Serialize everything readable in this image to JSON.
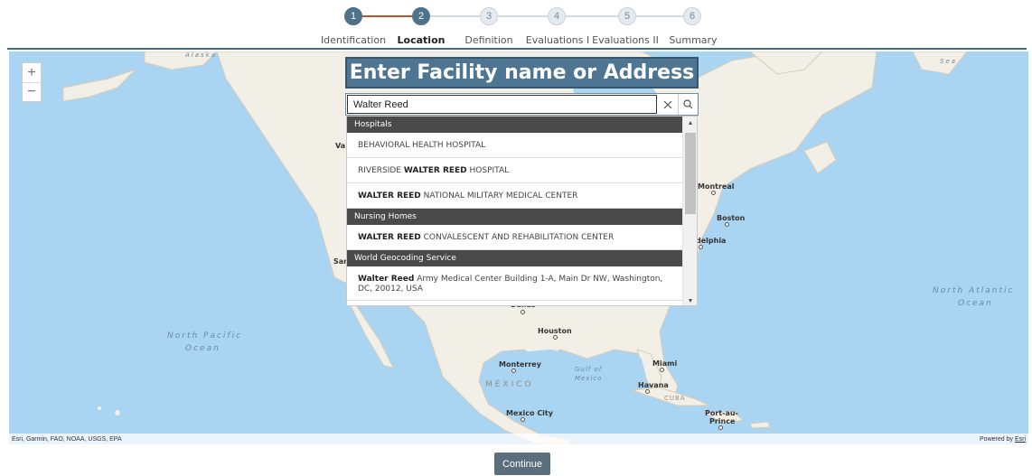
{
  "stepper": {
    "current_step": 2,
    "steps": [
      {
        "number": "1",
        "label": "Identification"
      },
      {
        "number": "2",
        "label": "Location"
      },
      {
        "number": "3",
        "label": "Definition"
      },
      {
        "number": "4",
        "label": "Evaluations I"
      },
      {
        "number": "5",
        "label": "Evaluations II"
      },
      {
        "number": "6",
        "label": "Summary"
      }
    ]
  },
  "search": {
    "title": "Enter Facility name or Address",
    "value": "Walter Reed",
    "clear_icon": "close-icon",
    "submit_icon": "search-icon"
  },
  "suggestions": {
    "hospitals_header": "Hospitals",
    "hospital_1": "BEHAVIORAL HEALTH HOSPITAL",
    "hospital_2_pre": "RIVERSIDE ",
    "hospital_2_match": "WALTER REED",
    "hospital_2_post": " HOSPITAL",
    "hospital_3_match": "WALTER REED",
    "hospital_3_post": " NATIONAL MILITARY MEDICAL CENTER",
    "nursing_header": "Nursing Homes",
    "nursing_1_match": "WALTER REED",
    "nursing_1_post": " CONVALESCENT AND REHABILITATION CENTER",
    "geocode_header": "World Geocoding Service",
    "geocode_1_match": "Walter Reed",
    "geocode_1_post": " Army Medical Center Building 1-A, Main Dr NW, Washington, DC, 20012, USA"
  },
  "map": {
    "zoom_in": "+",
    "zoom_out": "−",
    "labels": {
      "north_pacific": "North Pacific",
      "ocean_1": "Ocean",
      "north_atlantic": "North Atlantic",
      "ocean_2": "Ocean",
      "montreal": "Montreal",
      "boston": "Boston",
      "philadelphia": "delphia",
      "houston": "Houston",
      "dallas": "Dallas",
      "monterrey": "Monterrey",
      "mexico_country": "MÉXICO",
      "gulf": "Gulf of",
      "gulf_2": "Mexico",
      "miami": "Miami",
      "havana": "Havana",
      "cuba": "CUBA",
      "mexico_city": "Mexico City",
      "port_au_prince_1": "Port-au-",
      "port_au_prince_2": "Prince",
      "vancouver_partial": "Va",
      "san_partial": "San",
      "alaska_partial": "Alaska",
      "sea_partial": "Sea"
    },
    "attribution": "Esri, Garmin, FAO, NOAA, USGS, EPA",
    "powered_by": "Powered by ",
    "powered_link": "Esri"
  },
  "actions": {
    "continue": "Continue"
  },
  "colors": {
    "accent": "#4e7591",
    "progress_done": "#c1502e",
    "button": "#5b6e7c"
  }
}
